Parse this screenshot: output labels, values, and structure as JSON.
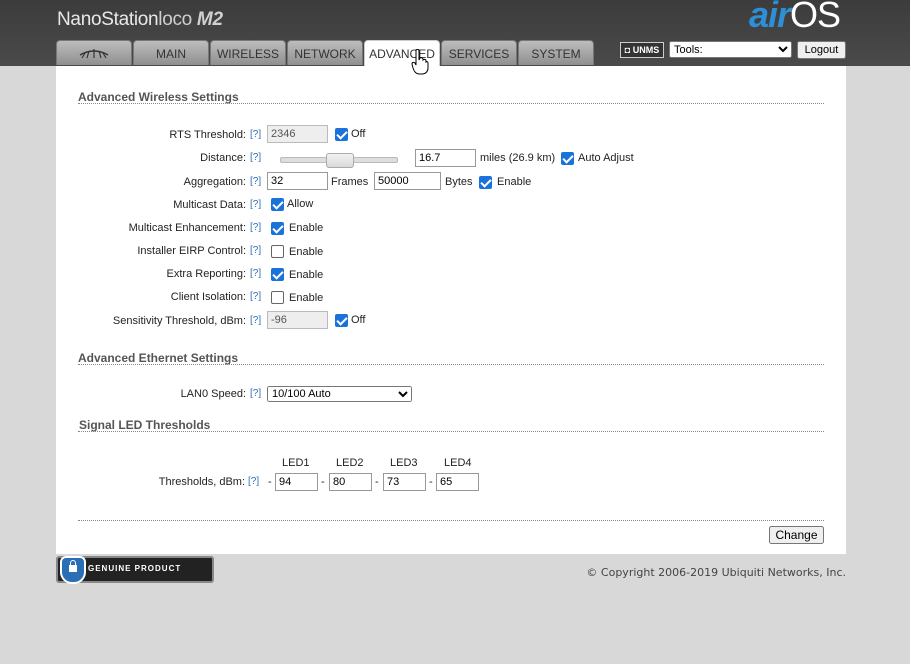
{
  "header": {
    "brand_main": "NanoStation",
    "brand_loco": "loco",
    "brand_model": "M2",
    "os_logo_air": "air",
    "os_logo_os": "OS",
    "tabs": [
      {
        "label": "",
        "icon": "ubiquiti-logo-icon"
      },
      {
        "label": "MAIN"
      },
      {
        "label": "WIRELESS"
      },
      {
        "label": "NETWORK"
      },
      {
        "label": "ADVANCED",
        "active": true
      },
      {
        "label": "SERVICES"
      },
      {
        "label": "SYSTEM"
      }
    ],
    "unms_label": "UNMS",
    "tools_selected": "Tools:",
    "logout_label": "Logout"
  },
  "wireless": {
    "title": "Advanced Wireless Settings",
    "help": "[?]",
    "rts_label": "RTS Threshold:",
    "rts_value": "2346",
    "rts_off_checked": true,
    "rts_off_label": "Off",
    "distance_label": "Distance:",
    "distance_value": "16.7",
    "distance_unit": "miles (26.9 km)",
    "auto_adjust_checked": true,
    "auto_adjust_label": "Auto Adjust",
    "aggregation_label": "Aggregation:",
    "aggregation_frames": "32",
    "frames_label": "Frames",
    "aggregation_bytes": "50000",
    "bytes_label": "Bytes",
    "aggregation_enable_checked": true,
    "enable_label": "Enable",
    "multicast_data_label": "Multicast Data:",
    "multicast_data_checked": true,
    "allow_label": "Allow",
    "multicast_enh_label": "Multicast Enhancement:",
    "multicast_enh_checked": true,
    "eirp_label": "Installer EIRP Control:",
    "eirp_checked": false,
    "extra_reporting_label": "Extra Reporting:",
    "extra_reporting_checked": true,
    "client_isolation_label": "Client Isolation:",
    "client_isolation_checked": false,
    "sensitivity_label": "Sensitivity Threshold, dBm:",
    "sensitivity_value": "-96",
    "sensitivity_off_checked": true,
    "off_label": "Off"
  },
  "ethernet": {
    "title": "Advanced Ethernet Settings",
    "lan0_label": "LAN0 Speed:",
    "lan0_value": "10/100 Auto"
  },
  "led": {
    "title": "Signal LED Thresholds",
    "thresholds_label": "Thresholds, dBm:",
    "headers": [
      "LED1",
      "LED2",
      "LED3",
      "LED4"
    ],
    "values": [
      "94",
      "80",
      "73",
      "65"
    ],
    "dash": "-"
  },
  "footer": {
    "change_label": "Change",
    "genuine_text": "GENUINE PRODUCT",
    "copyright": "© Copyright 2006-2019 Ubiquiti Networks, Inc."
  },
  "colors": {
    "accent": "#1a73d9",
    "airos_blue": "#2d8fd6"
  }
}
